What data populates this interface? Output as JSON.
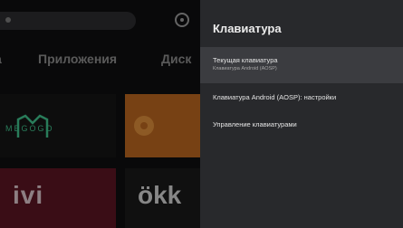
{
  "background": {
    "nav_apps": "Приложения",
    "nav_partial": "Диск",
    "tiles": {
      "megogo": "MEGOGO",
      "ivi": "ivi",
      "okko": "ökk"
    }
  },
  "panel": {
    "title": "Клавиатура",
    "items": [
      {
        "label": "Текущая клавиатура",
        "subtitle": "Клавиатура Android (AOSP)"
      },
      {
        "label": "Клавиатура Android (AOSP): настройки"
      },
      {
        "label": "Управление клавиатурами"
      }
    ]
  },
  "colors": {
    "panel": "#28292c",
    "selected": "#3b3c40"
  }
}
